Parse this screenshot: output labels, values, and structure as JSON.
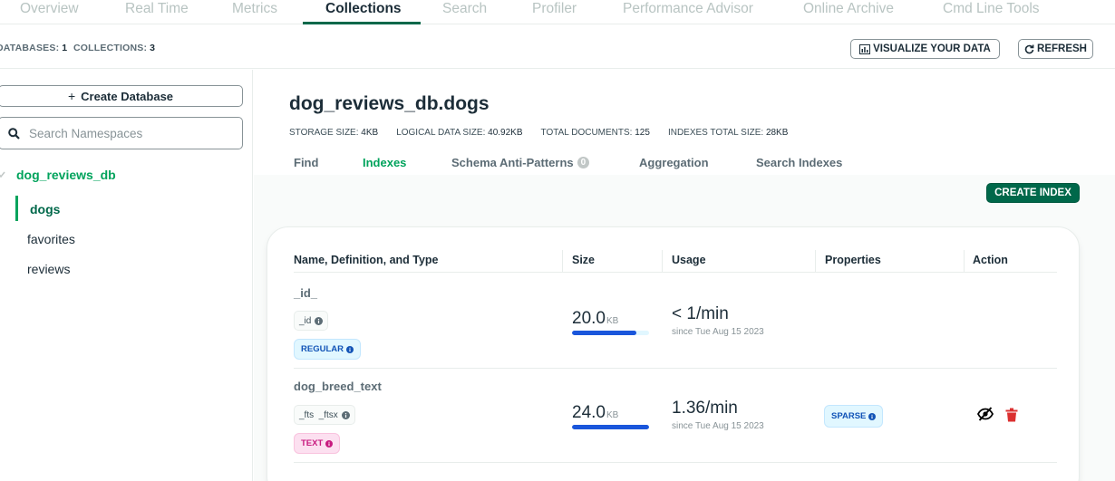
{
  "top_tabs": [
    "Overview",
    "Real Time",
    "Metrics",
    "Collections",
    "Search",
    "Profiler",
    "Performance Advisor",
    "Online Archive",
    "Cmd Line Tools"
  ],
  "active_top_tab": "Collections",
  "stats": {
    "databases_label": "DATABASES:",
    "databases_value": "1",
    "collections_label": "COLLECTIONS:",
    "collections_value": "3"
  },
  "buttons": {
    "visualize": "VISUALIZE YOUR DATA",
    "refresh": "REFRESH",
    "create_database": "Create Database",
    "create_index": "CREATE INDEX"
  },
  "sidebar": {
    "search_placeholder": "Search Namespaces",
    "database": "dog_reviews_db",
    "collections": [
      "dogs",
      "favorites",
      "reviews"
    ],
    "active_collection": "dogs"
  },
  "namespace": {
    "title": "dog_reviews_db.dogs",
    "storage_size_label": "STORAGE SIZE:",
    "storage_size": "4KB",
    "logical_size_label": "LOGICAL DATA SIZE:",
    "logical_size": "40.92KB",
    "total_docs_label": "TOTAL DOCUMENTS:",
    "total_docs": "125",
    "indexes_size_label": "INDEXES TOTAL SIZE:",
    "indexes_size": "28KB"
  },
  "sub_tabs": {
    "find": "Find",
    "indexes": "Indexes",
    "schema": "Schema Anti-Patterns",
    "schema_count": "0",
    "aggregation": "Aggregation",
    "search_indexes": "Search Indexes"
  },
  "table": {
    "headers": [
      "Name, Definition, and Type",
      "Size",
      "Usage",
      "Properties",
      "Action"
    ],
    "rows": [
      {
        "name": "_id_",
        "key": "_id",
        "type": "REGULAR",
        "size": "20.0",
        "size_unit": "KB",
        "size_fill": 0.83,
        "usage": "< 1/min",
        "since": "since Tue Aug 15 2023",
        "property": ""
      },
      {
        "name": "dog_breed_text",
        "key": "_fts  _ftsx",
        "type": "TEXT",
        "size": "24.0",
        "size_unit": "KB",
        "size_fill": 1.0,
        "usage": "1.36/min",
        "since": "since Tue Aug 15 2023",
        "property": "SPARSE"
      }
    ]
  },
  "colors": {
    "brand_green": "#00684a",
    "accent_green": "#00a35c",
    "bar_blue": "#1a56db",
    "delete_red": "#db3030"
  }
}
